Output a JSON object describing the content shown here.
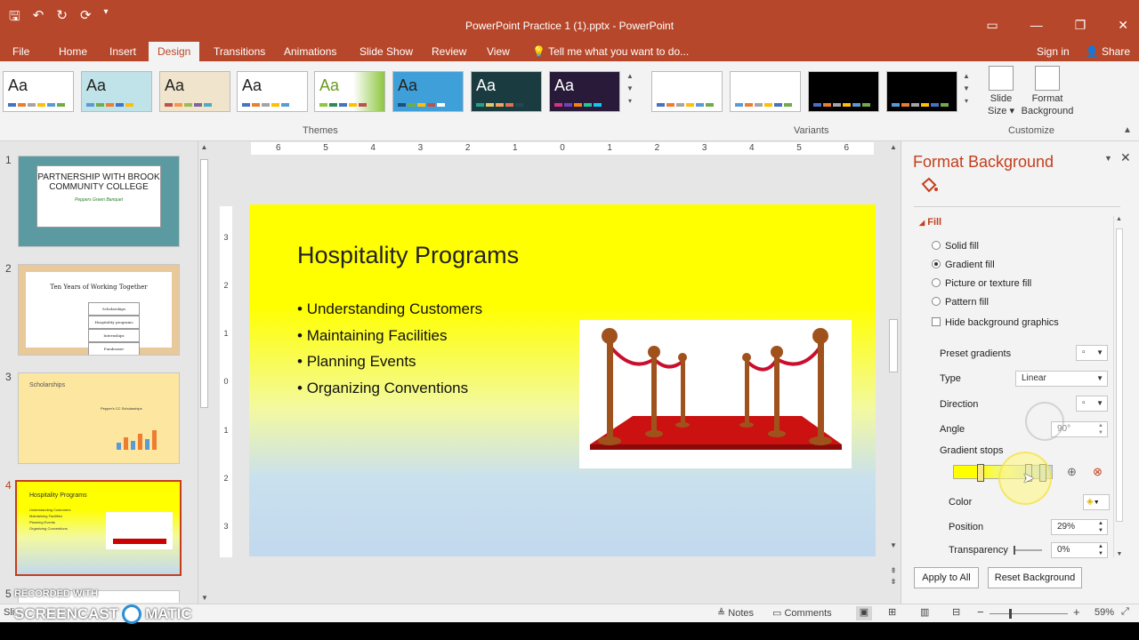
{
  "window": {
    "title": "PowerPoint Practice 1 (1).pptx - PowerPoint"
  },
  "tabs": [
    "File",
    "Home",
    "Insert",
    "Design",
    "Transitions",
    "Animations",
    "Slide Show",
    "Review",
    "View"
  ],
  "active_tab": "Design",
  "tell_me": "Tell me what you want to do...",
  "sign_in": "Sign in",
  "share": "Share",
  "ribbon": {
    "theme_glyph": "Aa",
    "themes_label": "Themes",
    "variants_label": "Variants",
    "customize_label": "Customize",
    "slide_size_line1": "Slide",
    "slide_size_line2": "Size",
    "format_bg_line1": "Format",
    "format_bg_line2": "Background"
  },
  "thumbnails": [
    {
      "num": "1",
      "text": "PARTNERSHIP WITH BROOK COMMUNITY COLLEGE",
      "sub": "Peppers Green Banquet"
    },
    {
      "num": "2",
      "text": "Ten Years of Working Together",
      "items": [
        "Scholarships",
        "Hospitality programs",
        "Internships",
        "Fundraiser"
      ]
    },
    {
      "num": "3",
      "text": "Scholarships",
      "chart": "Pepper's CC Scholarships"
    },
    {
      "num": "4",
      "text": "Hospitality Programs"
    },
    {
      "num": "5"
    }
  ],
  "slide": {
    "title": "Hospitality Programs",
    "bullets": [
      "Understanding Customers",
      "Maintaining Facilities",
      "Planning Events",
      "Organizing Conventions"
    ]
  },
  "ruler_labels": [
    "6",
    "5",
    "4",
    "3",
    "2",
    "1",
    "0",
    "1",
    "2",
    "3",
    "4",
    "5",
    "6"
  ],
  "vruler_labels": [
    "3",
    "2",
    "1",
    "0",
    "1",
    "2",
    "3"
  ],
  "pane": {
    "title": "Format Background",
    "section": "Fill",
    "fill_options": [
      {
        "label": "Solid fill",
        "selected": false
      },
      {
        "label": "Gradient fill",
        "selected": true
      },
      {
        "label": "Picture or texture fill",
        "selected": false
      },
      {
        "label": "Pattern fill",
        "selected": false
      }
    ],
    "hide_graphics": "Hide background graphics",
    "preset_gradients": "Preset gradients",
    "type_label": "Type",
    "type_value": "Linear",
    "direction_label": "Direction",
    "angle_label": "Angle",
    "angle_value": "90°",
    "gradient_stops": "Gradient stops",
    "color_label": "Color",
    "position_label": "Position",
    "position_value": "29%",
    "transparency_label": "Transparency",
    "transparency_value": "0%",
    "apply_all": "Apply to All",
    "reset": "Reset Background"
  },
  "status": {
    "slide_info": "Sli",
    "notes": "Notes",
    "comments": "Comments",
    "zoom": "59%"
  },
  "watermark": {
    "line1": "RECORDED WITH",
    "line2": "SCREENCAST",
    "line3": "MATIC"
  },
  "colors": {
    "accent": "#b7472a",
    "pane_title": "#c43e1c",
    "slide_top": "#ffff00",
    "slide_bottom": "#c2d9ee"
  }
}
